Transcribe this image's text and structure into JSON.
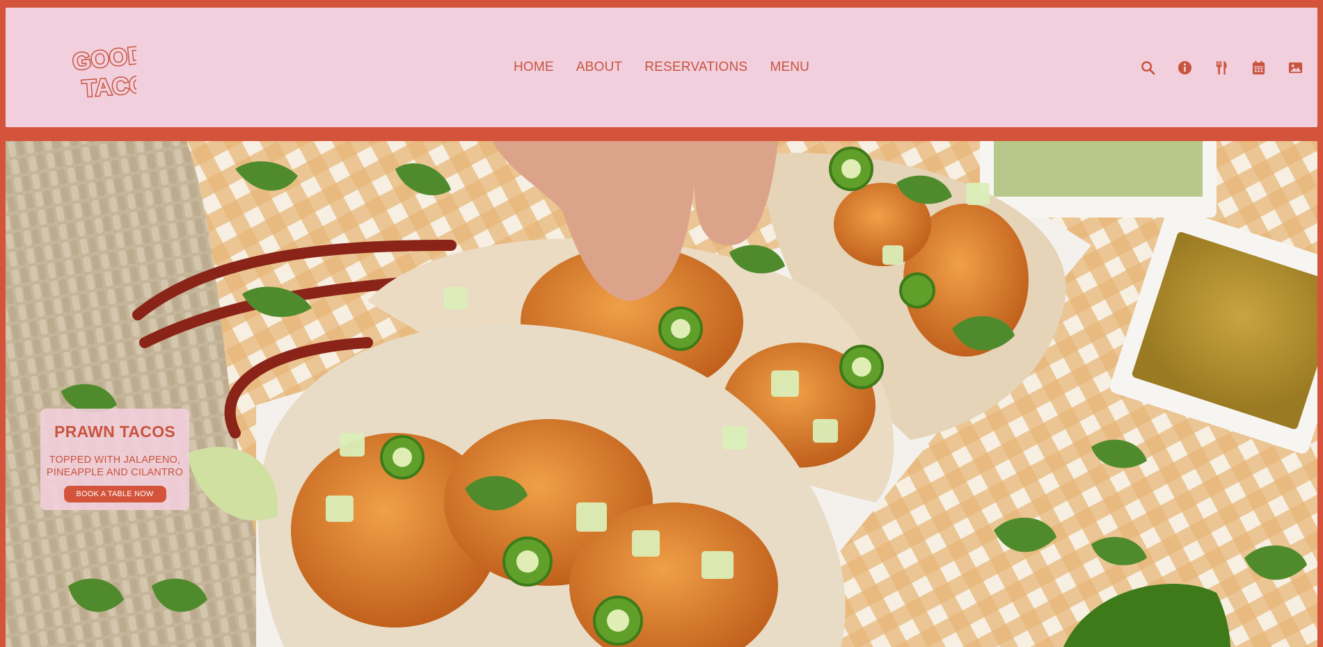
{
  "brand": {
    "logo_line1": "GOOD",
    "logo_line2": "TACO",
    "accent": "#d4533b",
    "header_bg": "#f2cfdd"
  },
  "nav": {
    "items": [
      {
        "label": "HOME"
      },
      {
        "label": "ABOUT"
      },
      {
        "label": "RESERVATIONS"
      },
      {
        "label": "MENU"
      }
    ]
  },
  "toolbar_icons": [
    "search-icon",
    "info-icon",
    "utensils-icon",
    "calendar-icon",
    "image-icon"
  ],
  "hero": {
    "title": "PRAWN TACOS",
    "subtitle": "TOPPED WITH JALAPENO, PINEAPPLE AND CILANTRO",
    "cta_label": "BOOK A TABLE NOW"
  }
}
